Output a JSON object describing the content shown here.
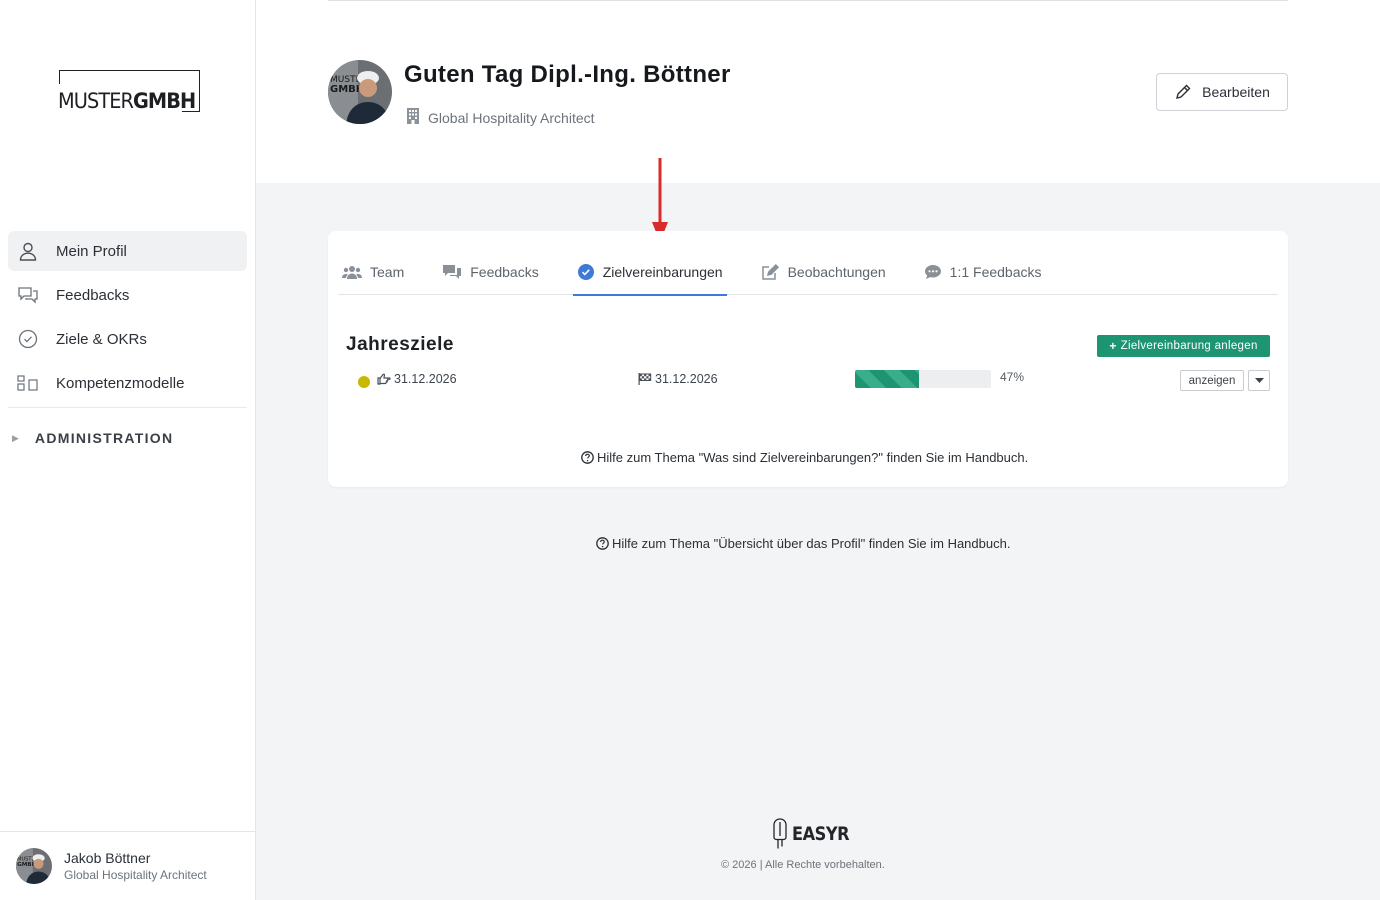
{
  "brand": {
    "logo_part1": "MUSTER",
    "logo_part2": "GMBH"
  },
  "sidebar": {
    "items": [
      {
        "label": "Mein Profil",
        "icon": "user-icon",
        "active": true
      },
      {
        "label": "Feedbacks",
        "icon": "chat-bubbles-icon",
        "active": false
      },
      {
        "label": "Ziele & OKRs",
        "icon": "check-circle-icon",
        "active": false
      },
      {
        "label": "Kompetenzmodelle",
        "icon": "grid-icon",
        "active": false
      }
    ],
    "admin_label": "ADMINISTRATION",
    "user": {
      "name": "Jakob Böttner",
      "role": "Global Hospitality Architect"
    }
  },
  "header": {
    "greeting": "Guten Tag Dipl.-Ing. Böttner",
    "role": "Global Hospitality Architect",
    "edit_label": "Bearbeiten"
  },
  "tabs": [
    {
      "label": "Team",
      "icon": "users-icon",
      "active": false
    },
    {
      "label": "Feedbacks",
      "icon": "comments-icon",
      "active": false
    },
    {
      "label": "Zielvereinbarungen",
      "icon": "check-circle-icon",
      "active": true
    },
    {
      "label": "Beobachtungen",
      "icon": "edit-icon",
      "active": false
    },
    {
      "label": "1:1 Feedbacks",
      "icon": "comment-dots-icon",
      "active": false
    }
  ],
  "goals": {
    "title": "Jahresziele",
    "add_label": "Zielvereinbarung anlegen",
    "rows": [
      {
        "status_color": "#c8b800",
        "start_date": "31.12.2026",
        "end_date": "31.12.2026",
        "progress": 47,
        "progress_label": "47%",
        "show_label": "anzeigen"
      }
    ],
    "help": "Hilfe zum Thema \"Was sind Zielvereinbarungen?\" finden Sie im Handbuch."
  },
  "page_help": "Hilfe zum Thema \"Übersicht über das Profil\" finden Sie im Handbuch.",
  "footer": {
    "brand": "EASYR",
    "copyright": "© 2026 | Alle Rechte vorbehalten."
  },
  "colors": {
    "accent_blue": "#3f7ad6",
    "primary_green": "#1d9573",
    "annotation_red": "#d92b2b"
  }
}
